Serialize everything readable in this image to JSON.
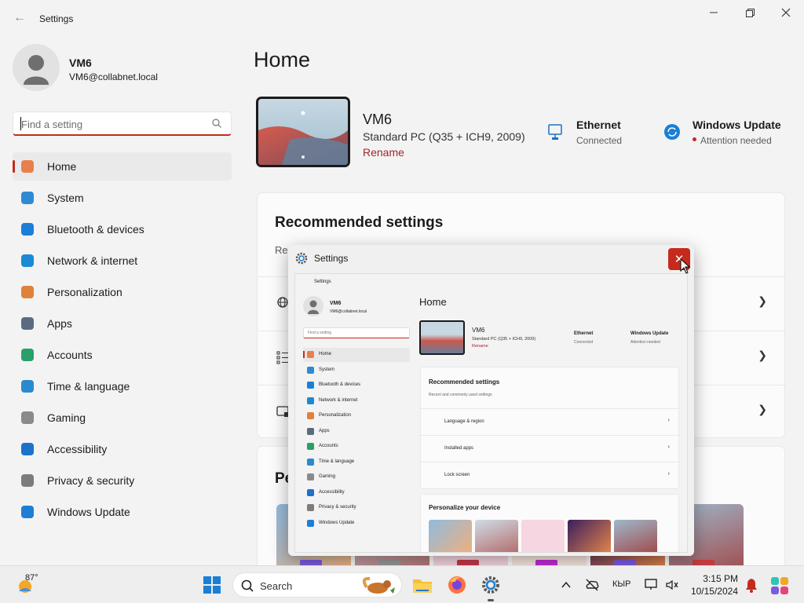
{
  "window": {
    "title": "Settings"
  },
  "user": {
    "name": "VM6",
    "email": "VM6@collabnet.local"
  },
  "search": {
    "placeholder": "Find a setting"
  },
  "nav": [
    {
      "label": "Home",
      "icon": "home-icon",
      "color": "#e8804b",
      "selected": true
    },
    {
      "label": "System",
      "icon": "system-icon",
      "color": "#2f8ad6"
    },
    {
      "label": "Bluetooth & devices",
      "icon": "bluetooth-icon",
      "color": "#1c7fd6"
    },
    {
      "label": "Network & internet",
      "icon": "wifi-icon",
      "color": "#1a8ad4"
    },
    {
      "label": "Personalization",
      "icon": "brush-icon",
      "color": "#e0813b"
    },
    {
      "label": "Apps",
      "icon": "apps-icon",
      "color": "#5a6b80"
    },
    {
      "label": "Accounts",
      "icon": "accounts-icon",
      "color": "#29a06a"
    },
    {
      "label": "Time & language",
      "icon": "globe-clock-icon",
      "color": "#2a8ad0"
    },
    {
      "label": "Gaming",
      "icon": "gamepad-icon",
      "color": "#8a8a8a"
    },
    {
      "label": "Accessibility",
      "icon": "accessibility-icon",
      "color": "#1c72c8"
    },
    {
      "label": "Privacy & security",
      "icon": "shield-icon",
      "color": "#7c7c7c"
    },
    {
      "label": "Windows Update",
      "icon": "update-icon",
      "color": "#1c7fd6"
    }
  ],
  "main": {
    "title": "Home",
    "device": {
      "name": "VM6",
      "spec": "Standard PC (Q35 + ICH9, 2009)",
      "rename": "Rename"
    },
    "ethernet": {
      "title": "Ethernet",
      "status": "Connected"
    },
    "update": {
      "title": "Windows Update",
      "status": "Attention needed"
    },
    "recommended": {
      "title": "Recommended settings",
      "subtitle": "Rec"
    },
    "personalize": {
      "title": "Pe"
    }
  },
  "preview": {
    "title": "Settings",
    "home": "Home",
    "device_name": "VM6",
    "device_spec": "Standard PC (Q35 + ICH9, 2009)",
    "rename": "Rename",
    "ethernet": "Ethernet",
    "ethernet_status": "Connected",
    "update": "Windows Update",
    "update_status": "Attention needed",
    "recommended_title": "Recommended settings",
    "recommended_sub": "Recent and commonly used settings",
    "rows": [
      "Language & region",
      "Installed apps",
      "Lock screen"
    ],
    "personalize_title": "Personalize your device",
    "search_placeholder": "Find a setting",
    "user_name": "VM6",
    "user_email": "VM6@collabnet.local"
  },
  "taskbar": {
    "weather": "87°",
    "search_label": "Search",
    "language": "КЫР",
    "time": "3:15 PM",
    "date": "10/15/2024"
  },
  "colors": {
    "accent": "#c42b1c",
    "link": "#a4262c",
    "attention": "#c42b1c"
  }
}
